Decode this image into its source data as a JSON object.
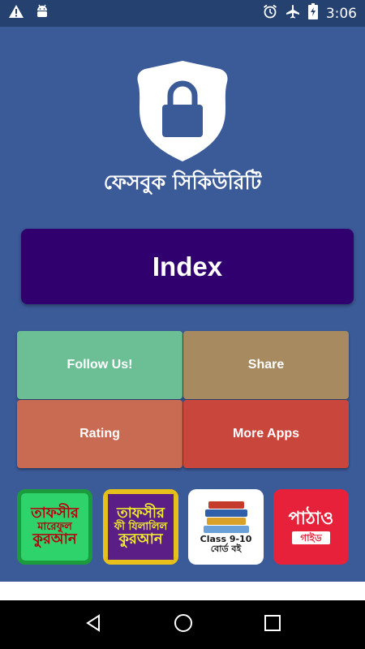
{
  "status_bar": {
    "time": "3:06",
    "icons": [
      "warning-icon",
      "android-icon",
      "alarm-icon",
      "airplane-icon",
      "battery-charging-icon"
    ]
  },
  "app": {
    "title": "ফেসবুক সিকিউরিটি",
    "logo": "shield-lock-icon"
  },
  "index_button": {
    "label": "Index"
  },
  "tiles": {
    "follow": "Follow Us!",
    "share": "Share",
    "rating": "Rating",
    "more": "More Apps"
  },
  "promo_apps": [
    {
      "line1": "তাফসীর",
      "line2": "মারেফুল",
      "line3": "কুরআন"
    },
    {
      "line1": "তাফসীর",
      "line2": "ফী যিলালিল",
      "line3": "কুরআন"
    },
    {
      "line1": "Class 9-10",
      "line2": "বোর্ড বই"
    },
    {
      "line1": "পাঠাও",
      "line2": "গাইড"
    }
  ],
  "nav_bar": {
    "icons": [
      "back-icon",
      "home-icon",
      "recents-icon"
    ]
  },
  "colors": {
    "background": "#3b5a98",
    "index_button": "#30006e",
    "follow": "#6cbf95",
    "share": "#a88a60",
    "rating": "#c96a52",
    "more": "#c9463d"
  }
}
